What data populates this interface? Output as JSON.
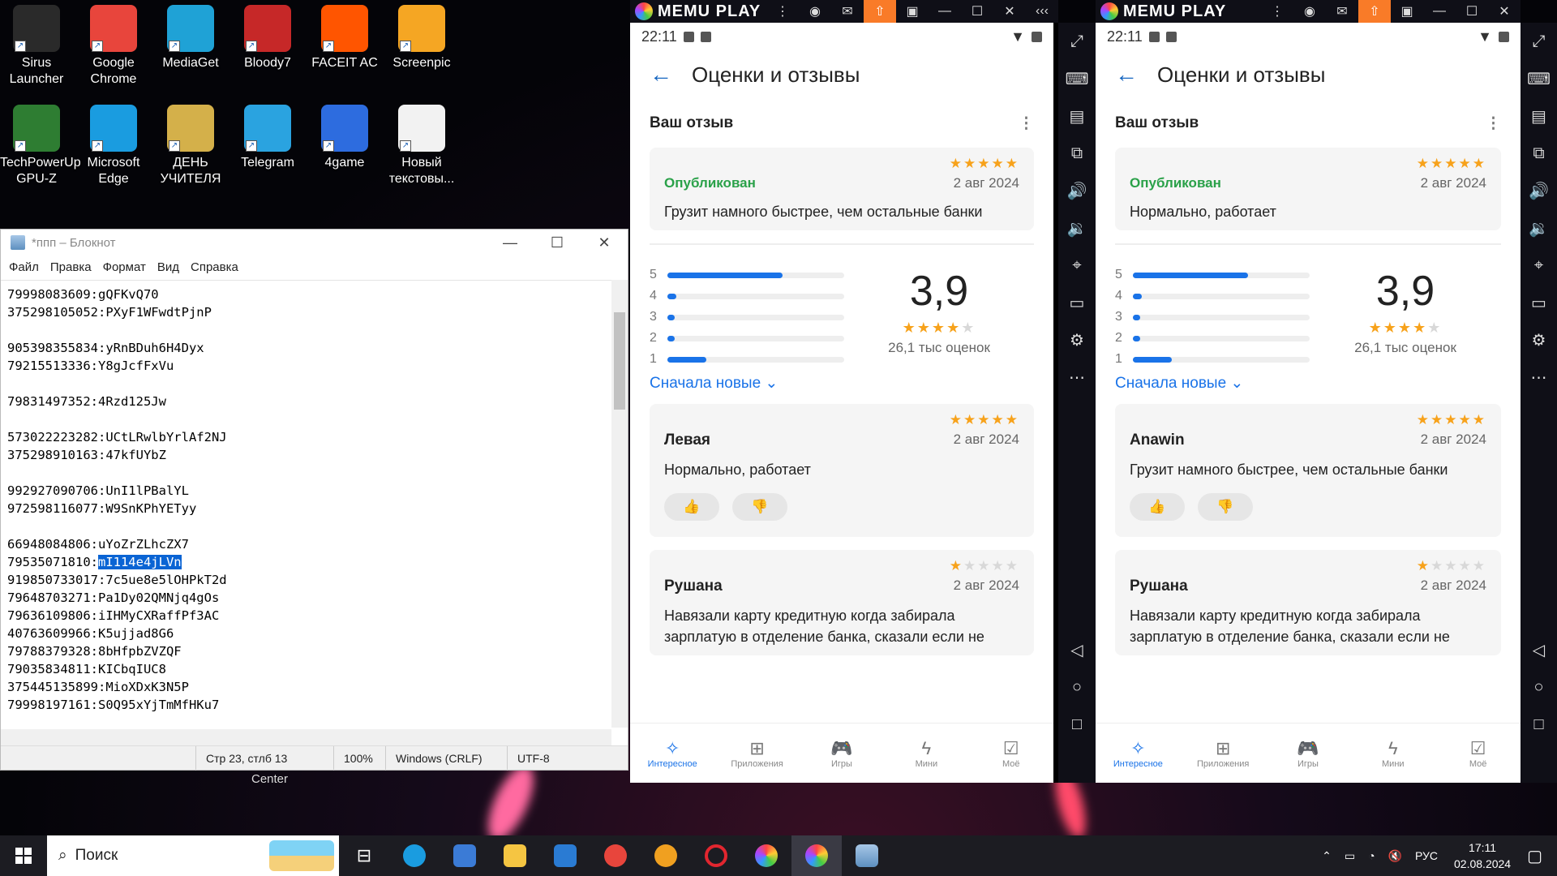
{
  "desktop": {
    "icons": [
      {
        "label": "Sirus Launcher",
        "color": "#2a2a2a"
      },
      {
        "label": "Google Chrome",
        "color": "#e8453c"
      },
      {
        "label": "MediaGet",
        "color": "#1fa2d6"
      },
      {
        "label": "Bloody7",
        "color": "#c62828"
      },
      {
        "label": "FACEIT AC",
        "color": "#ff5500"
      },
      {
        "label": "Screenpic",
        "color": "#f5a623"
      },
      {
        "label": "TechPowerUp GPU-Z",
        "color": "#2e7d32"
      },
      {
        "label": "Microsoft Edge",
        "color": "#1a9ce0"
      },
      {
        "label": "ДЕНЬ УЧИТЕЛЯ",
        "color": "#d4b04a"
      },
      {
        "label": "Telegram",
        "color": "#2aa3e0"
      },
      {
        "label": "4game",
        "color": "#2d6cdf"
      },
      {
        "label": "Новый текстовы...",
        "color": "#f2f2f2"
      }
    ],
    "below_notepad": "Center"
  },
  "notepad": {
    "title": "*ппп – Блокнот",
    "menu": [
      "Файл",
      "Правка",
      "Формат",
      "Вид",
      "Справка"
    ],
    "lines": [
      "79998083609:gQFKvQ70",
      "375298105052:PXyF1WFwdtPjnP",
      "",
      "905398355834:yRnBDuh6H4Dyx",
      "79215513336:Y8gJcfFxVu",
      "",
      "79831497352:4Rzd125Jw",
      "",
      "573022223282:UCtLRwlbYrlAf2NJ",
      "375298910163:47kfUYbZ",
      "",
      "992927090706:UnI1lPBalYL",
      "972598116077:W9SnKPhYETyy",
      "",
      "66948084806:uYoZrZLhcZX7",
      "79535071810:",
      "919850733017:7c5ue8e5lOHPkT2d",
      "79648703271:Pa1Dy02QMNjq4gOs",
      "79636109806:iIHMyCXRaffPf3AC",
      "40763609966:K5ujjad8G6",
      "79788379328:8bHfpbZVZQF",
      "79035834811:KICbqIUC8",
      "375445135899:MioXDxK3N5P",
      "79998197161:S0Q95xYjTmMfHKu7"
    ],
    "selected": "mI114e4jLVn",
    "status": {
      "pos": "Стр 23, стлб 13",
      "zoom": "100%",
      "eol": "Windows (CRLF)",
      "enc": "UTF-8"
    }
  },
  "memu": {
    "logo": "MEMU PLAY",
    "time": "22:11"
  },
  "store": {
    "header": "Оценки и отзывы",
    "your_review": "Ваш отзыв",
    "published": "Опубликован",
    "date": "2 авг 2024",
    "score": "3,9",
    "count": "26,1 тыс оценок",
    "sort": "Сначала новые",
    "rating_bars": [
      {
        "label": "5",
        "fraction": 0.65
      },
      {
        "label": "4",
        "fraction": 0.05
      },
      {
        "label": "3",
        "fraction": 0.04
      },
      {
        "label": "2",
        "fraction": 0.04
      },
      {
        "label": "1",
        "fraction": 0.22
      }
    ],
    "nav": [
      "Интересное",
      "Приложения",
      "Игры",
      "Мини",
      "Моё"
    ],
    "second_review_name": "Рушана",
    "second_review_text": "Навязали карту кредитную когда забирала зарплатую в отделение банка, сказали если не"
  },
  "left_phone": {
    "my_text": "Грузит намного быстрее, чем остальные банки",
    "review_name": "Левая",
    "review_text": "Нормально, работает"
  },
  "right_phone": {
    "my_text": "Нормально, работает",
    "review_name": "Anawin",
    "review_text": "Грузит намного быстрее, чем остальные банки"
  },
  "taskbar": {
    "search": "Поиск",
    "lang": "РУС",
    "time": "17:11",
    "date": "02.08.2024"
  }
}
